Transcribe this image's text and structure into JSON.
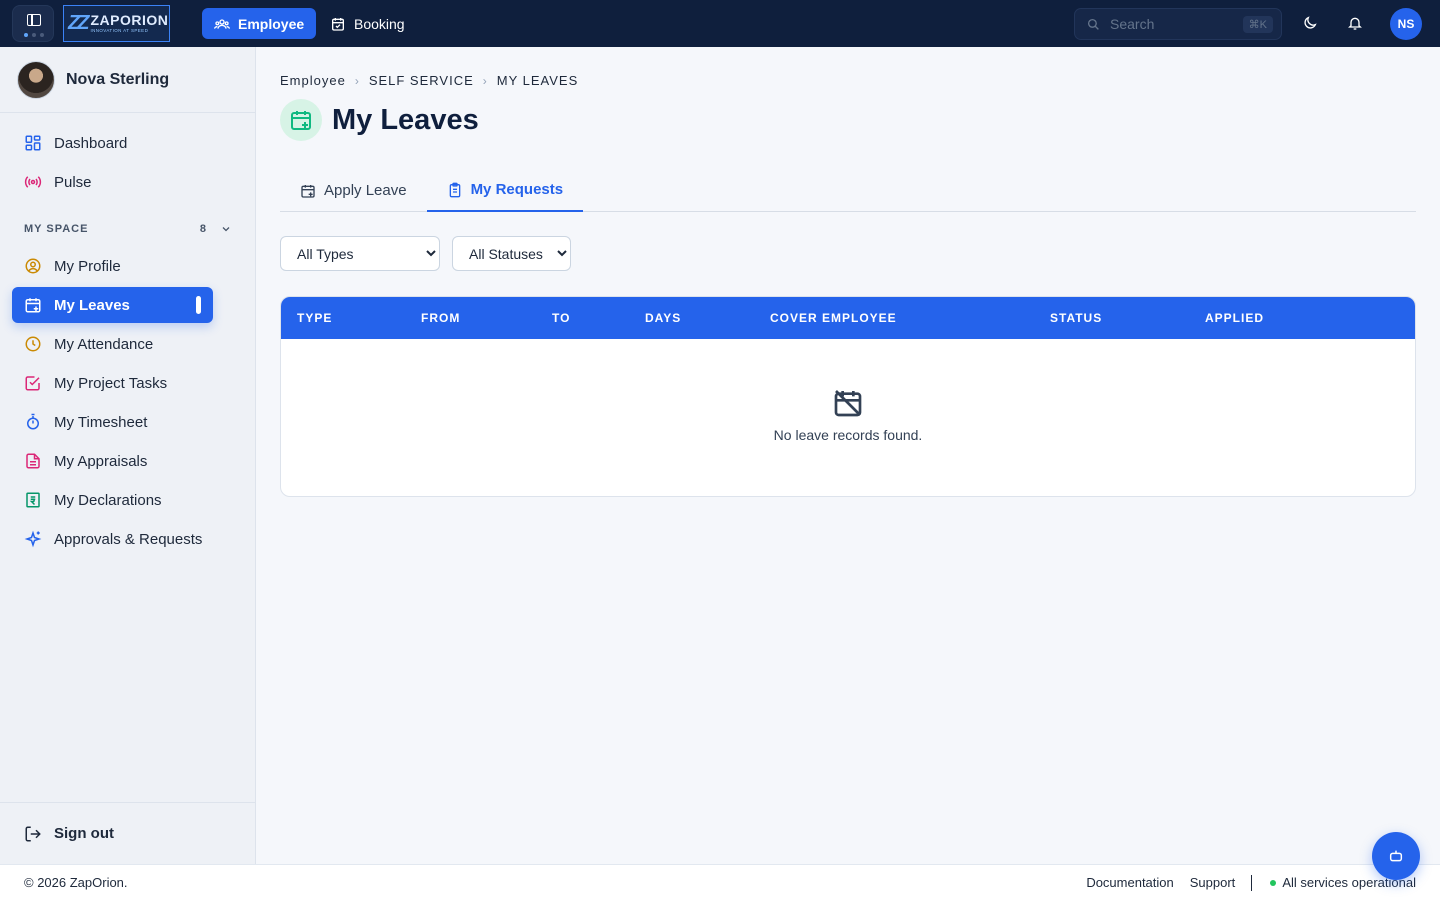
{
  "topbar": {
    "brand_name": "ZAPORION",
    "brand_tagline": "INNOVATION AT SPEED",
    "nav": [
      {
        "label": "Employee",
        "icon": "users-icon",
        "active": true
      },
      {
        "label": "Booking",
        "icon": "calendar-check-icon",
        "active": false
      }
    ],
    "search": {
      "placeholder": "Search",
      "shortcut": "⌘K"
    },
    "theme_icon": "moon-icon",
    "notifications_icon": "bell-icon",
    "avatar_initials": "NS"
  },
  "sidebar": {
    "user_name": "Nova Sterling",
    "primary_items": [
      {
        "label": "Dashboard",
        "icon": "grid-icon",
        "color": "#2563eb"
      },
      {
        "label": "Pulse",
        "icon": "broadcast-icon",
        "color": "#db2777"
      }
    ],
    "section": {
      "title": "MY SPACE",
      "count": "8"
    },
    "section_items": [
      {
        "label": "My Profile",
        "icon": "user-circle-icon",
        "color": "#ca8a04",
        "active": false
      },
      {
        "label": "My Leaves",
        "icon": "calendar-plus-icon",
        "color": "#ffffff",
        "active": true
      },
      {
        "label": "My Attendance",
        "icon": "clock-icon",
        "color": "#ca8a04",
        "active": false
      },
      {
        "label": "My Project Tasks",
        "icon": "check-square-icon",
        "color": "#db2777",
        "active": false
      },
      {
        "label": "My Timesheet",
        "icon": "stopwatch-icon",
        "color": "#2563eb",
        "active": false
      },
      {
        "label": "My Appraisals",
        "icon": "document-icon",
        "color": "#db2777",
        "active": false
      },
      {
        "label": "My Declarations",
        "icon": "rupee-receipt-icon",
        "color": "#059669",
        "active": false
      },
      {
        "label": "Approvals & Requests",
        "icon": "sparkles-icon",
        "color": "#2563eb",
        "active": false
      }
    ],
    "sign_out": "Sign out"
  },
  "main": {
    "breadcrumb": [
      "Employee",
      "SELF SERVICE",
      "MY LEAVES"
    ],
    "title": "My Leaves",
    "tabs": [
      {
        "label": "Apply Leave",
        "active": false
      },
      {
        "label": "My Requests",
        "active": true
      }
    ],
    "filters": {
      "type": {
        "selected": "All Types"
      },
      "status": {
        "selected": "All Statuses"
      }
    },
    "table": {
      "columns": [
        "TYPE",
        "FROM",
        "TO",
        "DAYS",
        "COVER EMPLOYEE",
        "STATUS",
        "APPLIED"
      ],
      "rows": [],
      "empty_message": "No leave records found."
    }
  },
  "footer": {
    "copyright": "© 2026 ZapOrion.",
    "links": [
      "Documentation",
      "Support"
    ],
    "status": "All services operational"
  },
  "colors": {
    "topbar": "#0f1f3d",
    "accent": "#2563eb",
    "status_ok": "#22c55e"
  },
  "fab_icon": "bot-icon"
}
